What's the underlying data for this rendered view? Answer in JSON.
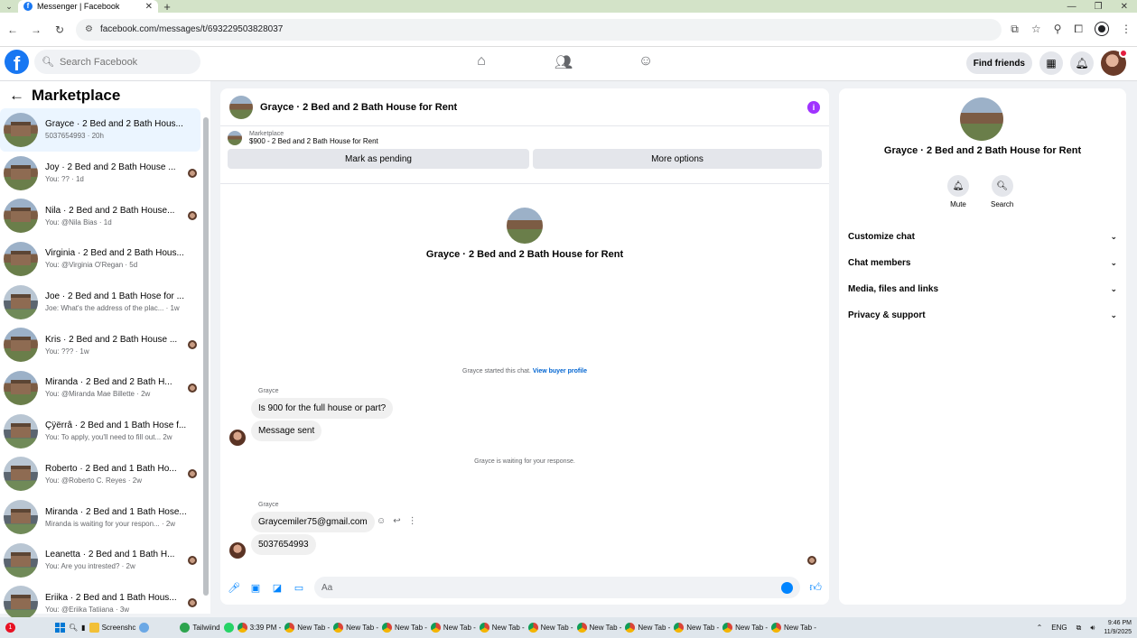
{
  "browser": {
    "tab_title": "Messenger | Facebook",
    "url": "facebook.com/messages/t/693229503828037",
    "new_tab_symbol": "+"
  },
  "fb_header": {
    "search_placeholder": "Search Facebook",
    "find_friends": "Find friends",
    "logo_letter": "f"
  },
  "sidebar": {
    "title": "Marketplace",
    "conversations": [
      {
        "name": "Grayce · 2 Bed and 2 Bath Hous...",
        "sub": "5037654993 · 20h"
      },
      {
        "name": "Joy · 2 Bed and 2 Bath House ...",
        "sub": "You: ?? · 1d"
      },
      {
        "name": "Nila · 2 Bed and 2 Bath House...",
        "sub": "You: @Nila Bias · 1d"
      },
      {
        "name": "Virginia · 2 Bed and 2 Bath Hous...",
        "sub": "You: @Virginia O'Regan · 5d"
      },
      {
        "name": "Joe · 2 Bed and 1 Bath Hose for ...",
        "sub": "Joe: What's the address of the plac... · 1w"
      },
      {
        "name": "Kris · 2 Bed and 2 Bath House ...",
        "sub": "You: ??? · 1w"
      },
      {
        "name": "Miranda · 2 Bed and 2 Bath H...",
        "sub": "You: @Miranda Mae Billette · 2w"
      },
      {
        "name": "Çÿërrâ · 2 Bed and 1 Bath Hose f...",
        "sub": "You: To apply, you'll need to fill out... 2w"
      },
      {
        "name": "Roberto · 2 Bed and 1 Bath Ho...",
        "sub": "You: @Roberto C. Reyes · 2w"
      },
      {
        "name": "Miranda · 2 Bed and 1 Bath Hose...",
        "sub": "Miranda is waiting for your respon... · 2w"
      },
      {
        "name": "Leanetta · 2 Bed and 1 Bath H...",
        "sub": "You: Are you intrested? · 2w"
      },
      {
        "name": "Eriika · 2 Bed and 1 Bath Hous...",
        "sub": "You: @Eriika Tatiiana · 3w"
      }
    ]
  },
  "chat": {
    "title": "Grayce · 2 Bed and 2 Bath House for Rent",
    "marketplace_label": "Marketplace",
    "listing": "$900 - 2 Bed and 2 Bath House for Rent",
    "mark_pending": "Mark as pending",
    "more_options": "More options",
    "hero_title": "Grayce · 2 Bed and 2 Bath House for Rent",
    "system_started": "Grayce started this chat.",
    "view_buyer_profile": "View buyer profile",
    "sender_name_1": "Grayce",
    "msg1": "Is 900 for the full house or part?",
    "msg2": "Message sent",
    "system_waiting": "Grayce is waiting for your response.",
    "sender_name_2": "Grayce",
    "msg3": "Graycemiler75@gmail.com",
    "msg4": "5037654993",
    "composer_placeholder": "Aa"
  },
  "right_panel": {
    "title": "Grayce · 2 Bed and 2 Bath House for Rent",
    "mute_label": "Mute",
    "search_label": "Search",
    "sections": [
      "Customize chat",
      "Chat members",
      "Media, files and links",
      "Privacy & support"
    ]
  },
  "taskbar": {
    "screenshot_label": "Screenshc",
    "tailwind_label": "Tailwiind",
    "chrome_time_label": "3:39 PM -",
    "new_tab_label": "New Tab -",
    "lang": "ENG",
    "time": "9:46 PM",
    "date": "11/9/2025",
    "notification_count": "1"
  },
  "colors": {
    "fb_blue": "#1877f2",
    "messenger_blue": "#0084ff",
    "info_purple": "#a033ff",
    "active_conv": "#ebf5ff"
  }
}
